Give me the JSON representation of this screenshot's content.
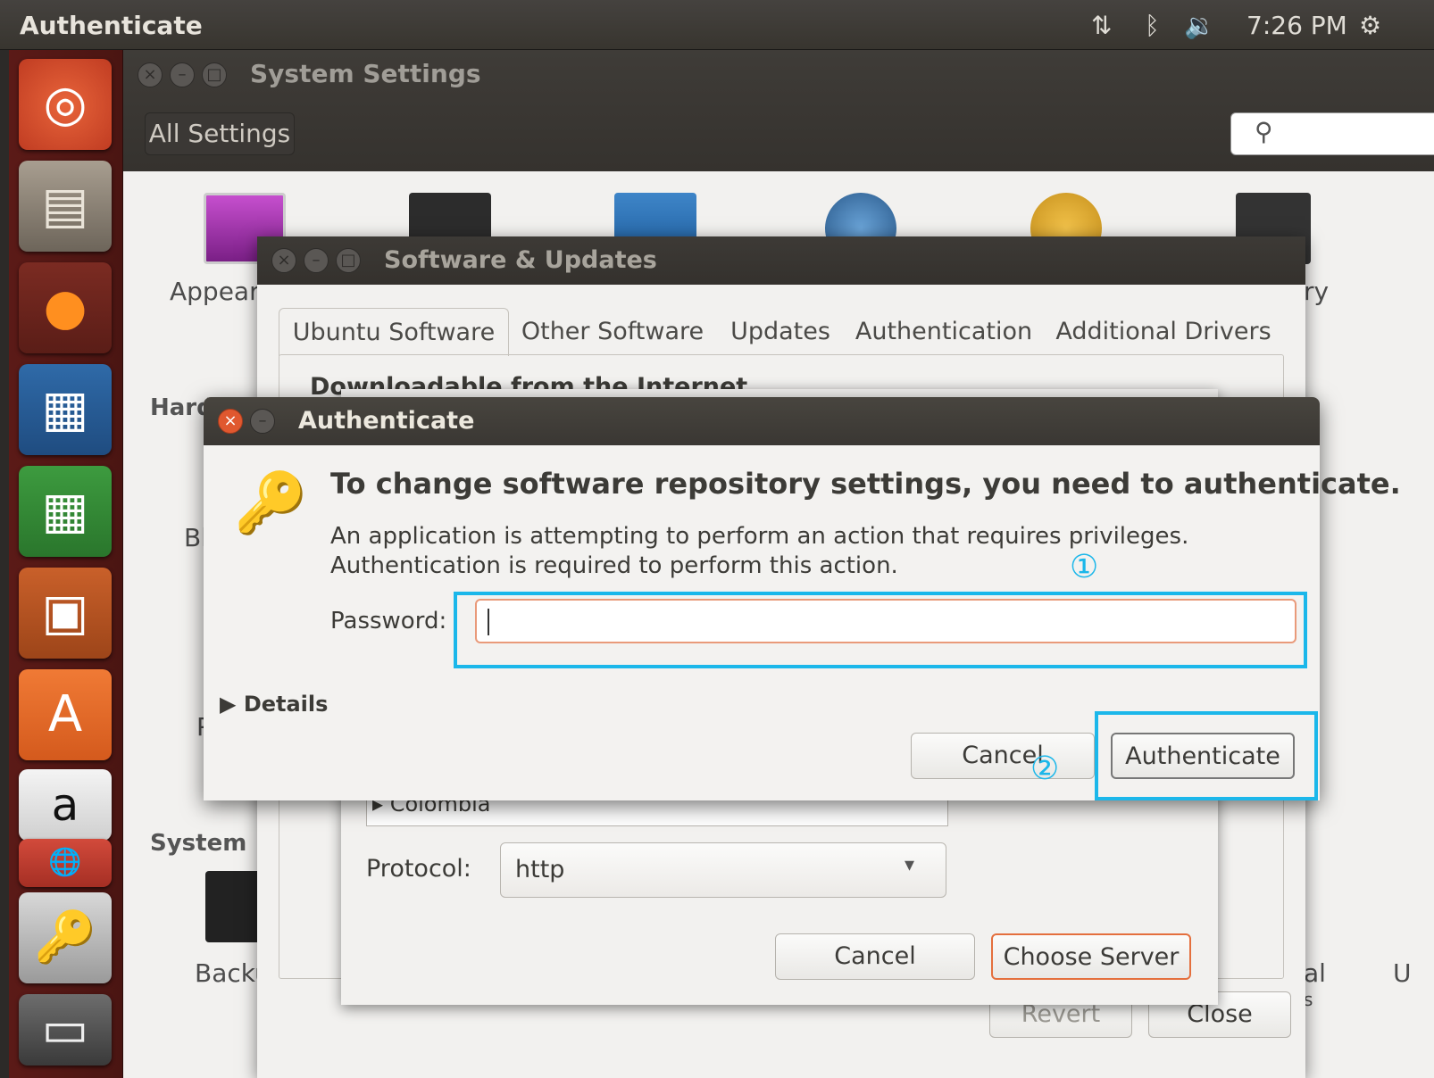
{
  "topbar": {
    "title": "Authenticate",
    "network_icon": "network-updown-icon",
    "bluetooth_icon": "bluetooth-icon",
    "volume_icon": "volume-icon",
    "clock": "7:26 PM",
    "power_icon": "power-gear-icon"
  },
  "launcher": {
    "items": [
      "ubuntu-dash",
      "files",
      "firefox",
      "libreoffice-writer",
      "libreoffice-calc",
      "libreoffice-impress",
      "ubuntu-software",
      "amazon",
      "software-updater",
      "passwords-and-keys",
      "removable-drive"
    ]
  },
  "system_settings": {
    "title": "System Settings",
    "all_settings": "All Settings",
    "search_placeholder": "",
    "labels": {
      "appearance": "Appear",
      "security_tail": "ry",
      "hardware": "Hard",
      "bl": "Bl",
      "p": "P",
      "system": "System",
      "backup": "Backu",
      "al": "al",
      "s": "s",
      "u": "U"
    }
  },
  "software_updates": {
    "title": "Software & Updates",
    "tabs": [
      "Ubuntu Software",
      "Other Software",
      "Updates",
      "Authentication",
      "Additional Drivers"
    ],
    "downloadable": "Downloadable from the Internet",
    "revert": "Revert",
    "close": "Close"
  },
  "choose_server": {
    "list_item": "Colombia",
    "protocol_label": "Protocol:",
    "protocol_value": "http",
    "cancel": "Cancel",
    "choose_server": "Choose Server"
  },
  "auth_dialog": {
    "title": "Authenticate",
    "heading": "To change software repository settings, you need to authenticate.",
    "body_line1": "An application is attempting to perform an action that requires privileges.",
    "body_line2": "Authentication is required to perform this action.",
    "password_label": "Password:",
    "password_value": "",
    "details": "Details",
    "cancel": "Cancel",
    "authenticate": "Authenticate",
    "marker1": "①",
    "marker2": "②"
  },
  "colors": {
    "highlight": "#1bb7ea",
    "focus": "#e46f3d",
    "close_button": "#e0582f"
  }
}
